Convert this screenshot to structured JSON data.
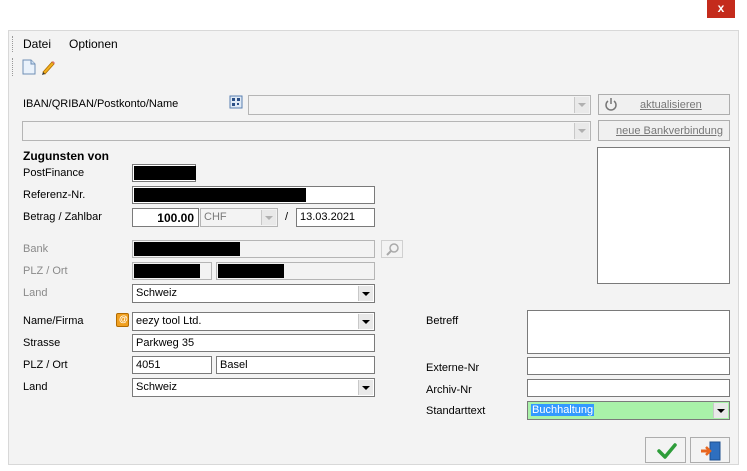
{
  "window": {
    "close_label": "x"
  },
  "menu": {
    "items": [
      "Datei",
      "Optionen"
    ]
  },
  "toolbar": {
    "icons": [
      "new-document-icon",
      "edit-pencil-icon"
    ]
  },
  "search": {
    "label": "IBAN/QRIBAN/Postkonto/Name",
    "icon": "qr-code-icon",
    "refresh_label": "aktualisieren",
    "new_bank_label": "neue Bankverbindung"
  },
  "zugunsten": {
    "title": "Zugunsten von",
    "postfinance_label": "PostFinance",
    "referenz_label": "Referenz-Nr.",
    "betrag_label": "Betrag / Zahlbar",
    "betrag_value": "100.00",
    "currency": "CHF",
    "date_separator": "/",
    "date_value": "13.03.2021"
  },
  "bank": {
    "bank_label": "Bank",
    "plz_label": "PLZ / Ort",
    "land_label": "Land",
    "land_value": "Schweiz"
  },
  "empfaenger": {
    "name_label": "Name/Firma",
    "name_value": "eezy tool Ltd.",
    "strasse_label": "Strasse",
    "strasse_value": "Parkweg 35",
    "plz_label": "PLZ / Ort",
    "plz_value": "4051",
    "ort_value": "Basel",
    "land_label": "Land",
    "land_value": "Schweiz"
  },
  "right": {
    "betreff_label": "Betreff",
    "externe_label": "Externe-Nr",
    "archiv_label": "Archiv-Nr",
    "standard_label": "Standarttext",
    "standard_value": "Buchhaltung"
  },
  "actions": {
    "ok_icon": "checkmark-icon",
    "exit_icon": "exit-door-icon"
  }
}
